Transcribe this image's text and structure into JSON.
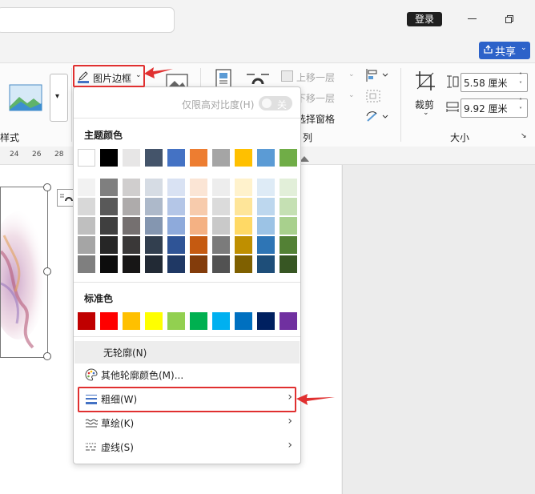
{
  "titlebar": {
    "login": "登录",
    "share": "共享"
  },
  "ribbon": {
    "picture_border": "图片边框",
    "styles_group": "样式",
    "bring_forward": "上移一层",
    "send_backward": "下移一层",
    "selection_pane": "选择窗格",
    "arrange_group": "列",
    "crop": "裁剪",
    "size_group": "大小",
    "height_value": "5.58 厘米",
    "width_value": "9.92 厘米"
  },
  "ruler": {
    "ticks": [
      "24",
      "26",
      "28"
    ]
  },
  "menu": {
    "high_contrast_only": "仅限高对比度(H)",
    "toggle_state": "关",
    "theme_colors_title": "主题颜色",
    "standard_colors_title": "标准色",
    "no_outline": "无轮廓(N)",
    "more_outline_colors": "其他轮廓颜色(M)...",
    "weight": "粗细(W)",
    "sketched": "草绘(K)",
    "dashes": "虚线(S)"
  },
  "colors": {
    "theme_top": [
      "#ffffff",
      "#000000",
      "#e7e6e6",
      "#44546a",
      "#4472c4",
      "#ed7d31",
      "#a5a5a5",
      "#ffc000",
      "#5b9bd5",
      "#70ad47"
    ],
    "theme_shades": [
      [
        "#f2f2f2",
        "#7f7f7f",
        "#d0cece",
        "#d6dce4",
        "#d9e2f3",
        "#fbe5d5",
        "#ededed",
        "#fff2cc",
        "#deebf6",
        "#e2efd9"
      ],
      [
        "#d8d8d8",
        "#595959",
        "#aeabab",
        "#adb9ca",
        "#b4c6e7",
        "#f7cbac",
        "#dbdbdb",
        "#fee599",
        "#bdd7ee",
        "#c5e0b3"
      ],
      [
        "#bfbfbf",
        "#3f3f3f",
        "#757070",
        "#8496b0",
        "#8eaadb",
        "#f4b183",
        "#c9c9c9",
        "#ffd965",
        "#9cc3e5",
        "#a8d08d"
      ],
      [
        "#a5a5a5",
        "#262626",
        "#3a3838",
        "#323f4f",
        "#2f5496",
        "#c55a11",
        "#7b7b7b",
        "#bf8f00",
        "#2e75b5",
        "#538135"
      ],
      [
        "#7f7f7f",
        "#0c0c0c",
        "#171616",
        "#222a35",
        "#1f3864",
        "#833c0b",
        "#525252",
        "#7f6000",
        "#1e4e79",
        "#375623"
      ]
    ],
    "standard": [
      "#c00000",
      "#ff0000",
      "#ffc000",
      "#ffff00",
      "#92d050",
      "#00b050",
      "#00b0f0",
      "#0070c0",
      "#002060",
      "#7030a0"
    ],
    "accent_red": "#e03030",
    "share_blue": "#2c62c9"
  }
}
